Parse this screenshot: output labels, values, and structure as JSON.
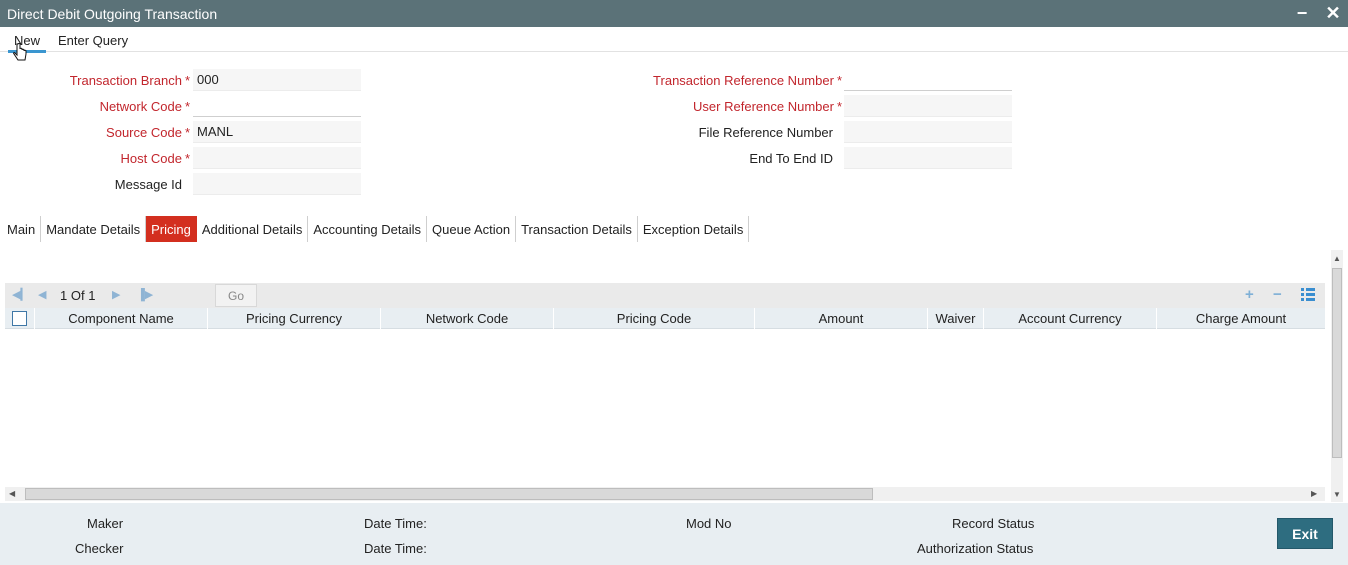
{
  "window": {
    "title": "Direct Debit Outgoing Transaction",
    "minimize_glyph": "−",
    "close_glyph": "✕"
  },
  "menu": {
    "new_label": "New",
    "enter_query_label": "Enter Query"
  },
  "form": {
    "transaction_branch": {
      "label": "Transaction Branch",
      "value": "000"
    },
    "network_code": {
      "label": "Network Code",
      "value": ""
    },
    "source_code": {
      "label": "Source Code",
      "value": "MANL"
    },
    "host_code": {
      "label": "Host Code",
      "value": ""
    },
    "message_id": {
      "label": "Message Id",
      "value": ""
    },
    "transaction_reference_number": {
      "label": "Transaction Reference Number",
      "value": ""
    },
    "user_reference_number": {
      "label": "User Reference Number",
      "value": ""
    },
    "file_reference_number": {
      "label": "File Reference Number",
      "value": ""
    },
    "end_to_end_id": {
      "label": "End To End ID",
      "value": ""
    },
    "required_marker": "*"
  },
  "tabs": [
    {
      "label": "Main"
    },
    {
      "label": "Mandate Details"
    },
    {
      "label": "Pricing",
      "active": true
    },
    {
      "label": "Additional Details"
    },
    {
      "label": "Accounting Details"
    },
    {
      "label": "Queue Action"
    },
    {
      "label": "Transaction Details"
    },
    {
      "label": "Exception Details"
    }
  ],
  "grid": {
    "pagination": {
      "current": "1",
      "of_label": "Of",
      "total": "1",
      "go_label": "Go"
    },
    "columns": [
      "Component Name",
      "Pricing Currency",
      "Network Code",
      "Pricing Code",
      "Amount",
      "Waiver",
      "Account Currency",
      "Charge Amount"
    ],
    "rows": []
  },
  "footer": {
    "maker_label": "Maker",
    "checker_label": "Checker",
    "date_time_label_1": "Date Time:",
    "date_time_label_2": "Date Time:",
    "mod_no_label": "Mod No",
    "record_status_label": "Record Status",
    "authorization_status_label": "Authorization Status",
    "exit_label": "Exit"
  },
  "colors": {
    "titlebar": "#5b7278",
    "active_tab": "#d32f1f",
    "required": "#c2262d",
    "exit_button": "#2e6d80",
    "footer_bg": "#e8eef2"
  },
  "icons": [
    "minimize-icon",
    "close-icon",
    "hand-cursor-icon",
    "first-page-icon",
    "prev-page-icon",
    "next-page-icon",
    "last-page-icon",
    "add-row-icon",
    "delete-row-icon",
    "view-row-icon"
  ]
}
